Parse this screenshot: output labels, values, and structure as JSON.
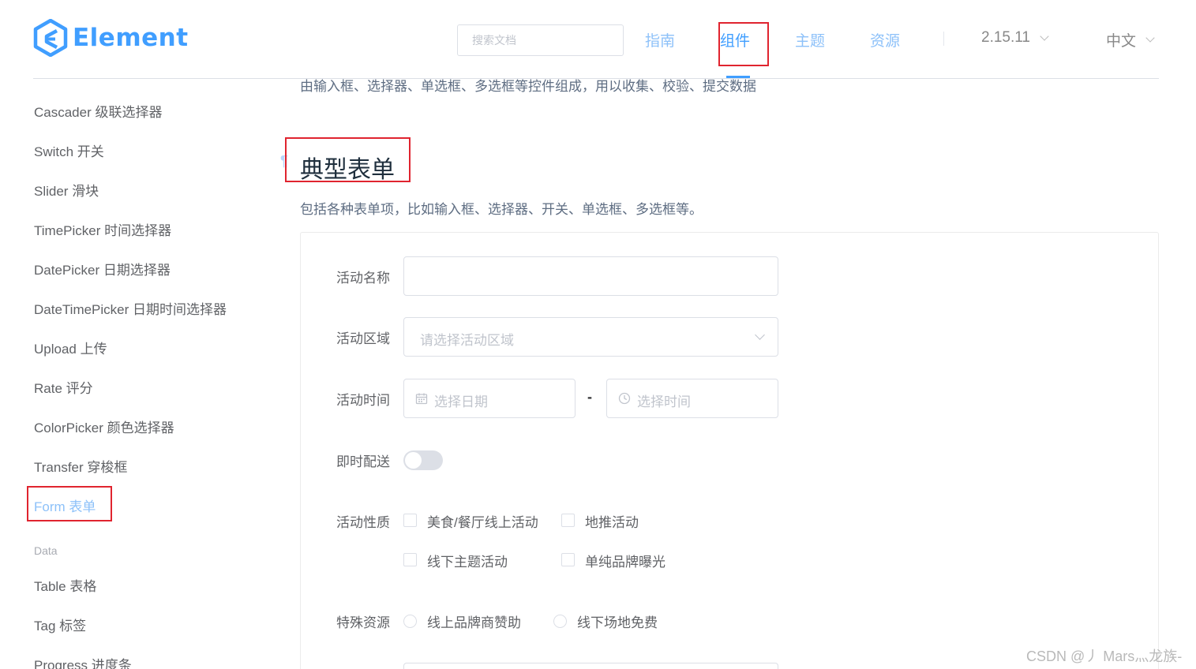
{
  "header": {
    "logo_text": "Element",
    "search_placeholder": "搜索文档",
    "nav": {
      "guide": "指南",
      "component": "组件",
      "theme": "主题",
      "resource": "资源"
    },
    "version": "2.15.11",
    "language": "中文"
  },
  "sidebar": {
    "items": [
      "Cascader 级联选择器",
      "Switch 开关",
      "Slider 滑块",
      "TimePicker 时间选择器",
      "DatePicker 日期选择器",
      "DateTimePicker 日期时间选择器",
      "Upload 上传",
      "Rate 评分",
      "ColorPicker 颜色选择器",
      "Transfer 穿梭框",
      "Form 表单"
    ],
    "group_data": "Data",
    "data_items": [
      "Table 表格",
      "Tag 标签",
      "Progress 进度条"
    ]
  },
  "main": {
    "intro": "由输入框、选择器、单选框、多选框等控件组成，用以收集、校验、提交数据",
    "anchor": "¶",
    "section_title": "典型表单",
    "section_desc": "包括各种表单项，比如输入框、选择器、开关、单选框、多选框等。",
    "form": {
      "name_label": "活动名称",
      "name_value": "",
      "region_label": "活动区域",
      "region_placeholder": "请选择活动区域",
      "time_label": "活动时间",
      "date_placeholder": "选择日期",
      "time_separator": "-",
      "time_placeholder": "选择时间",
      "delivery_label": "即时配送",
      "delivery_on": false,
      "type_label": "活动性质",
      "type_options": [
        "美食/餐厅线上活动",
        "地推活动",
        "线下主题活动",
        "单纯品牌曝光"
      ],
      "resource_label": "特殊资源",
      "resource_options": [
        "线上品牌商赞助",
        "线下场地免费"
      ]
    }
  },
  "watermark": "CSDN @丿 Mars灬龙族-",
  "colors": {
    "primary": "#409EFF",
    "highlight_box": "#e0242f"
  }
}
